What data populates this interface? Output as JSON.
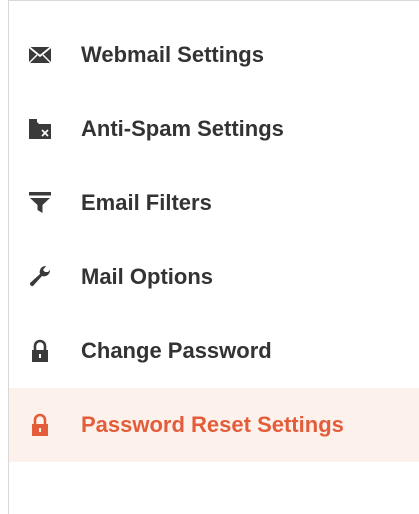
{
  "colors": {
    "text": "#333333",
    "icon": "#333333",
    "active_text": "#e35d3a",
    "active_background": "#fdf1ec",
    "border": "#d9d9d9"
  },
  "menu": {
    "items": [
      {
        "label": "Webmail Settings",
        "icon": "envelope-icon",
        "active": false
      },
      {
        "label": "Anti-Spam Settings",
        "icon": "spam-folder-icon",
        "active": false
      },
      {
        "label": "Email Filters",
        "icon": "filter-icon",
        "active": false
      },
      {
        "label": "Mail Options",
        "icon": "wrench-icon",
        "active": false
      },
      {
        "label": "Change Password",
        "icon": "lock-icon",
        "active": false
      },
      {
        "label": "Password Reset Settings",
        "icon": "lock-icon",
        "active": true
      }
    ]
  }
}
